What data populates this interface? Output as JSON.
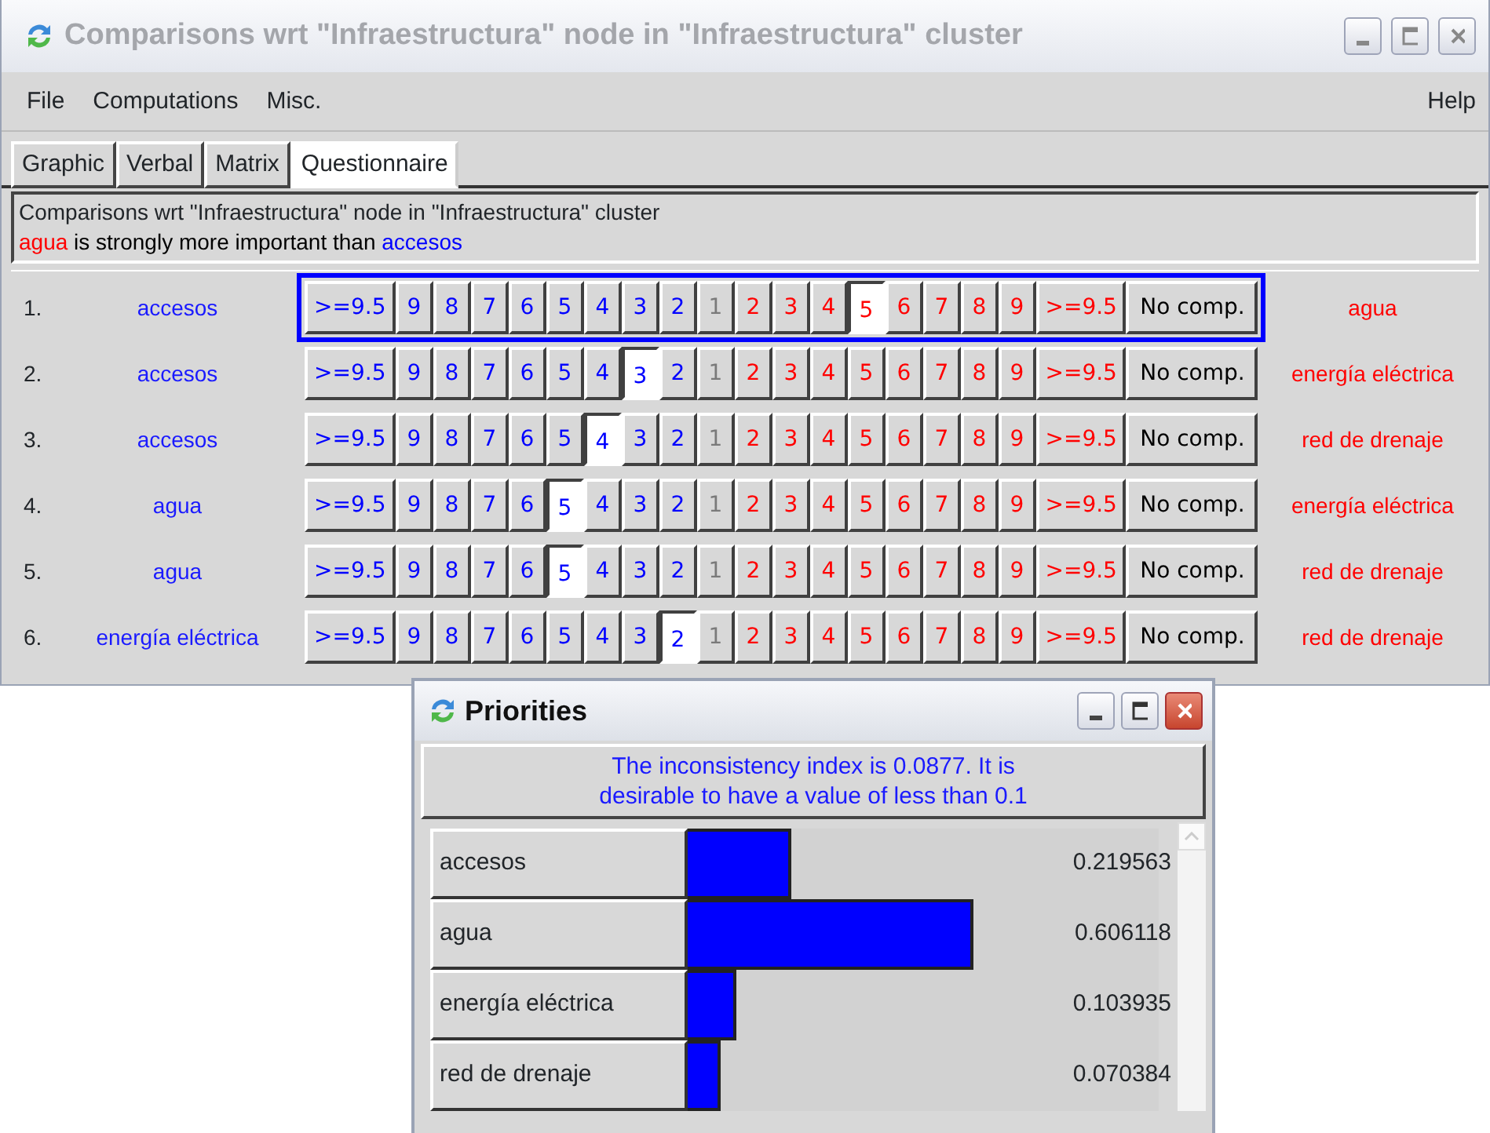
{
  "window": {
    "title": "Comparisons wrt \"Infraestructura\" node in \"Infraestructura\" cluster"
  },
  "menu": [
    {
      "label": "File"
    },
    {
      "label": "Computations"
    },
    {
      "label": "Misc."
    },
    {
      "label": "Help",
      "kind": "right"
    }
  ],
  "tabs": [
    {
      "label": "Graphic",
      "selected": false
    },
    {
      "label": "Verbal",
      "selected": false
    },
    {
      "label": "Matrix",
      "selected": false
    },
    {
      "label": "Questionnaire",
      "selected": true
    }
  ],
  "header": {
    "title": "Comparisons wrt \"Infraestructura\" node in \"Infraestructura\" cluster",
    "message": [
      {
        "text": "agua",
        "kind": "right"
      },
      {
        "text": " is strongly more important than ",
        "kind": "plain"
      },
      {
        "text": "accesos",
        "kind": "left"
      }
    ]
  },
  "comparisons": [
    {
      "number": "1.",
      "left": "accesos",
      "right": "agua",
      "focused": true,
      "scale": [
        {
          "label": ">=9.5",
          "kind": "left",
          "selected": false
        },
        {
          "label": "9",
          "kind": "left",
          "selected": false
        },
        {
          "label": "8",
          "kind": "left",
          "selected": false
        },
        {
          "label": "7",
          "kind": "left",
          "selected": false
        },
        {
          "label": "6",
          "kind": "left",
          "selected": false
        },
        {
          "label": "5",
          "kind": "left",
          "selected": false
        },
        {
          "label": "4",
          "kind": "left",
          "selected": false
        },
        {
          "label": "3",
          "kind": "left",
          "selected": false
        },
        {
          "label": "2",
          "kind": "left",
          "selected": false
        },
        {
          "label": "1",
          "kind": "equal",
          "selected": false
        },
        {
          "label": "2",
          "kind": "right",
          "selected": false
        },
        {
          "label": "3",
          "kind": "right",
          "selected": false
        },
        {
          "label": "4",
          "kind": "right",
          "selected": false
        },
        {
          "label": "5",
          "kind": "right",
          "selected": true
        },
        {
          "label": "6",
          "kind": "right",
          "selected": false
        },
        {
          "label": "7",
          "kind": "right",
          "selected": false
        },
        {
          "label": "8",
          "kind": "right",
          "selected": false
        },
        {
          "label": "9",
          "kind": "right",
          "selected": false
        },
        {
          "label": ">=9.5",
          "kind": "right",
          "selected": false
        },
        {
          "label": "No comp.",
          "kind": "none",
          "selected": false
        }
      ]
    },
    {
      "number": "2.",
      "left": "accesos",
      "right": "energía eléctrica",
      "focused": false,
      "scale": [
        {
          "label": ">=9.5",
          "kind": "left",
          "selected": false
        },
        {
          "label": "9",
          "kind": "left",
          "selected": false
        },
        {
          "label": "8",
          "kind": "left",
          "selected": false
        },
        {
          "label": "7",
          "kind": "left",
          "selected": false
        },
        {
          "label": "6",
          "kind": "left",
          "selected": false
        },
        {
          "label": "5",
          "kind": "left",
          "selected": false
        },
        {
          "label": "4",
          "kind": "left",
          "selected": false
        },
        {
          "label": "3",
          "kind": "left",
          "selected": true
        },
        {
          "label": "2",
          "kind": "left",
          "selected": false
        },
        {
          "label": "1",
          "kind": "equal",
          "selected": false
        },
        {
          "label": "2",
          "kind": "right",
          "selected": false
        },
        {
          "label": "3",
          "kind": "right",
          "selected": false
        },
        {
          "label": "4",
          "kind": "right",
          "selected": false
        },
        {
          "label": "5",
          "kind": "right",
          "selected": false
        },
        {
          "label": "6",
          "kind": "right",
          "selected": false
        },
        {
          "label": "7",
          "kind": "right",
          "selected": false
        },
        {
          "label": "8",
          "kind": "right",
          "selected": false
        },
        {
          "label": "9",
          "kind": "right",
          "selected": false
        },
        {
          "label": ">=9.5",
          "kind": "right",
          "selected": false
        },
        {
          "label": "No comp.",
          "kind": "none",
          "selected": false
        }
      ]
    },
    {
      "number": "3.",
      "left": "accesos",
      "right": "red de drenaje",
      "focused": false,
      "scale": [
        {
          "label": ">=9.5",
          "kind": "left",
          "selected": false
        },
        {
          "label": "9",
          "kind": "left",
          "selected": false
        },
        {
          "label": "8",
          "kind": "left",
          "selected": false
        },
        {
          "label": "7",
          "kind": "left",
          "selected": false
        },
        {
          "label": "6",
          "kind": "left",
          "selected": false
        },
        {
          "label": "5",
          "kind": "left",
          "selected": false
        },
        {
          "label": "4",
          "kind": "left",
          "selected": true
        },
        {
          "label": "3",
          "kind": "left",
          "selected": false
        },
        {
          "label": "2",
          "kind": "left",
          "selected": false
        },
        {
          "label": "1",
          "kind": "equal",
          "selected": false
        },
        {
          "label": "2",
          "kind": "right",
          "selected": false
        },
        {
          "label": "3",
          "kind": "right",
          "selected": false
        },
        {
          "label": "4",
          "kind": "right",
          "selected": false
        },
        {
          "label": "5",
          "kind": "right",
          "selected": false
        },
        {
          "label": "6",
          "kind": "right",
          "selected": false
        },
        {
          "label": "7",
          "kind": "right",
          "selected": false
        },
        {
          "label": "8",
          "kind": "right",
          "selected": false
        },
        {
          "label": "9",
          "kind": "right",
          "selected": false
        },
        {
          "label": ">=9.5",
          "kind": "right",
          "selected": false
        },
        {
          "label": "No comp.",
          "kind": "none",
          "selected": false
        }
      ]
    },
    {
      "number": "4.",
      "left": "agua",
      "right": "energía eléctrica",
      "focused": false,
      "scale": [
        {
          "label": ">=9.5",
          "kind": "left",
          "selected": false
        },
        {
          "label": "9",
          "kind": "left",
          "selected": false
        },
        {
          "label": "8",
          "kind": "left",
          "selected": false
        },
        {
          "label": "7",
          "kind": "left",
          "selected": false
        },
        {
          "label": "6",
          "kind": "left",
          "selected": false
        },
        {
          "label": "5",
          "kind": "left",
          "selected": true
        },
        {
          "label": "4",
          "kind": "left",
          "selected": false
        },
        {
          "label": "3",
          "kind": "left",
          "selected": false
        },
        {
          "label": "2",
          "kind": "left",
          "selected": false
        },
        {
          "label": "1",
          "kind": "equal",
          "selected": false
        },
        {
          "label": "2",
          "kind": "right",
          "selected": false
        },
        {
          "label": "3",
          "kind": "right",
          "selected": false
        },
        {
          "label": "4",
          "kind": "right",
          "selected": false
        },
        {
          "label": "5",
          "kind": "right",
          "selected": false
        },
        {
          "label": "6",
          "kind": "right",
          "selected": false
        },
        {
          "label": "7",
          "kind": "right",
          "selected": false
        },
        {
          "label": "8",
          "kind": "right",
          "selected": false
        },
        {
          "label": "9",
          "kind": "right",
          "selected": false
        },
        {
          "label": ">=9.5",
          "kind": "right",
          "selected": false
        },
        {
          "label": "No comp.",
          "kind": "none",
          "selected": false
        }
      ]
    },
    {
      "number": "5.",
      "left": "agua",
      "right": "red de drenaje",
      "focused": false,
      "scale": [
        {
          "label": ">=9.5",
          "kind": "left",
          "selected": false
        },
        {
          "label": "9",
          "kind": "left",
          "selected": false
        },
        {
          "label": "8",
          "kind": "left",
          "selected": false
        },
        {
          "label": "7",
          "kind": "left",
          "selected": false
        },
        {
          "label": "6",
          "kind": "left",
          "selected": false
        },
        {
          "label": "5",
          "kind": "left",
          "selected": true
        },
        {
          "label": "4",
          "kind": "left",
          "selected": false
        },
        {
          "label": "3",
          "kind": "left",
          "selected": false
        },
        {
          "label": "2",
          "kind": "left",
          "selected": false
        },
        {
          "label": "1",
          "kind": "equal",
          "selected": false
        },
        {
          "label": "2",
          "kind": "right",
          "selected": false
        },
        {
          "label": "3",
          "kind": "right",
          "selected": false
        },
        {
          "label": "4",
          "kind": "right",
          "selected": false
        },
        {
          "label": "5",
          "kind": "right",
          "selected": false
        },
        {
          "label": "6",
          "kind": "right",
          "selected": false
        },
        {
          "label": "7",
          "kind": "right",
          "selected": false
        },
        {
          "label": "8",
          "kind": "right",
          "selected": false
        },
        {
          "label": "9",
          "kind": "right",
          "selected": false
        },
        {
          "label": ">=9.5",
          "kind": "right",
          "selected": false
        },
        {
          "label": "No comp.",
          "kind": "none",
          "selected": false
        }
      ]
    },
    {
      "number": "6.",
      "left": "energía eléctrica",
      "right": "red de drenaje",
      "focused": false,
      "scale": [
        {
          "label": ">=9.5",
          "kind": "left",
          "selected": false
        },
        {
          "label": "9",
          "kind": "left",
          "selected": false
        },
        {
          "label": "8",
          "kind": "left",
          "selected": false
        },
        {
          "label": "7",
          "kind": "left",
          "selected": false
        },
        {
          "label": "6",
          "kind": "left",
          "selected": false
        },
        {
          "label": "5",
          "kind": "left",
          "selected": false
        },
        {
          "label": "4",
          "kind": "left",
          "selected": false
        },
        {
          "label": "3",
          "kind": "left",
          "selected": false
        },
        {
          "label": "2",
          "kind": "left",
          "selected": true
        },
        {
          "label": "1",
          "kind": "equal",
          "selected": false
        },
        {
          "label": "2",
          "kind": "right",
          "selected": false
        },
        {
          "label": "3",
          "kind": "right",
          "selected": false
        },
        {
          "label": "4",
          "kind": "right",
          "selected": false
        },
        {
          "label": "5",
          "kind": "right",
          "selected": false
        },
        {
          "label": "6",
          "kind": "right",
          "selected": false
        },
        {
          "label": "7",
          "kind": "right",
          "selected": false
        },
        {
          "label": "8",
          "kind": "right",
          "selected": false
        },
        {
          "label": "9",
          "kind": "right",
          "selected": false
        },
        {
          "label": ">=9.5",
          "kind": "right",
          "selected": false
        },
        {
          "label": "No comp.",
          "kind": "none",
          "selected": false
        }
      ]
    }
  ],
  "priorities": {
    "title": "Priorities",
    "message": "The inconsistency index is 0.0877.  It is desirable to have a value of less than 0.1",
    "items": [
      {
        "name": "accesos",
        "level": 0.219563,
        "value": "0.219563"
      },
      {
        "name": "agua",
        "level": 0.606118,
        "value": "0.606118"
      },
      {
        "name": "energía eléctrica",
        "level": 0.103935,
        "value": "0.103935"
      },
      {
        "name": "red de drenaje",
        "level": 0.070384,
        "value": "0.070384"
      }
    ]
  }
}
